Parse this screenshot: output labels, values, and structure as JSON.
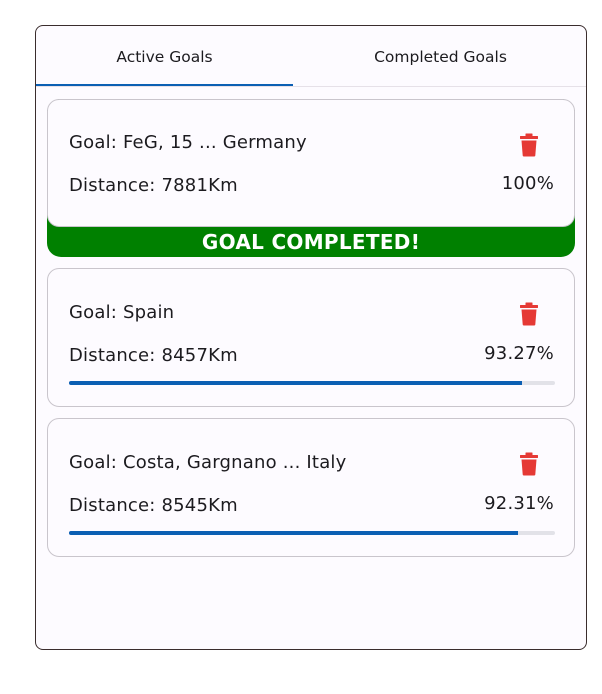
{
  "tabs": {
    "active_label": "Active Goals",
    "completed_label": "Completed Goals"
  },
  "colors": {
    "accent": "#0b5fb3",
    "delete": "#e53935",
    "completed_banner": "#008000"
  },
  "goals": [
    {
      "goal": "Goal: FeG, 15 ... Germany",
      "distance": "Distance: 7881Km",
      "percent": "100%",
      "progress": 1.0,
      "completed": true,
      "banner": "GOAL COMPLETED!",
      "icon": "trash-icon"
    },
    {
      "goal": "Goal: Spain",
      "distance": "Distance: 8457Km",
      "percent": "93.27%",
      "progress": 0.9327,
      "completed": false,
      "icon": "trash-icon"
    },
    {
      "goal": "Goal: Costa, Gargnano ... Italy",
      "distance": "Distance: 8545Km",
      "percent": "92.31%",
      "progress": 0.9231,
      "completed": false,
      "icon": "trash-icon"
    }
  ]
}
